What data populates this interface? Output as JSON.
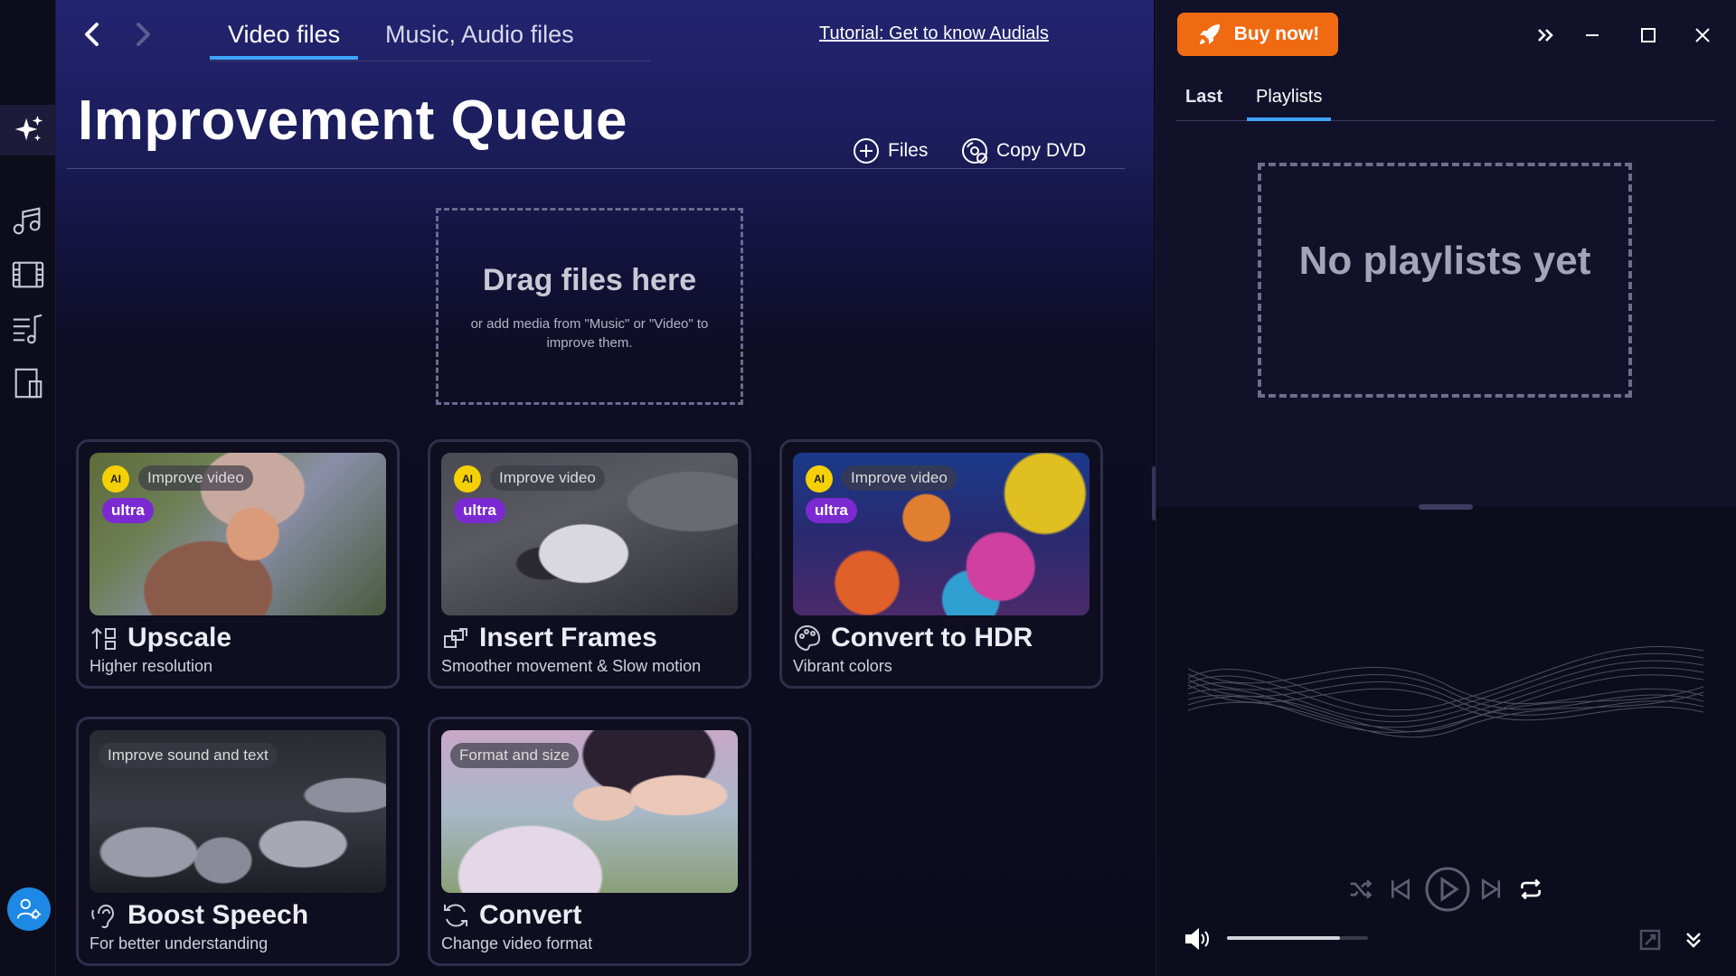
{
  "nav": {
    "tabs": [
      {
        "label": "Video files",
        "active": true
      },
      {
        "label": "Music, Audio files",
        "active": false
      }
    ],
    "tutorial_link": "Tutorial: Get to know Audials"
  },
  "page": {
    "title": "Improvement Queue",
    "actions": {
      "files": "Files",
      "copy_dvd": "Copy DVD"
    }
  },
  "dropzone": {
    "title": "Drag files here",
    "subtitle": "or add media from \"Music\" or \"Video\" to improve them."
  },
  "cards": [
    {
      "tag": "Improve video",
      "ai_badge": "AI",
      "quality": "ultra",
      "title": "Upscale",
      "subtitle": "Higher resolution",
      "icon": "upscale-icon"
    },
    {
      "tag": "Improve video",
      "ai_badge": "AI",
      "quality": "ultra",
      "title": "Insert Frames",
      "subtitle": "Smoother movement & Slow motion",
      "icon": "frames-icon"
    },
    {
      "tag": "Improve video",
      "ai_badge": "AI",
      "quality": "ultra",
      "title": "Convert to HDR",
      "subtitle": "Vibrant colors",
      "icon": "palette-icon"
    },
    {
      "tag": "Improve sound and text",
      "title": "Boost Speech",
      "subtitle": "For better understanding",
      "icon": "ear-icon"
    },
    {
      "tag": "Format and size",
      "title": "Convert",
      "subtitle": "Change video format",
      "icon": "convert-icon"
    }
  ],
  "right_panel": {
    "buy_label": "Buy now!",
    "tabs": [
      {
        "label": "Last",
        "active": false
      },
      {
        "label": "Playlists",
        "active": true
      }
    ],
    "empty_text": "No playlists yet"
  },
  "player": {
    "volume": 0.8
  },
  "colors": {
    "accent": "#3ea4ff",
    "buy": "#f06a12",
    "ai_badge": "#f5d000",
    "ultra": "#7a2ad0",
    "user": "#1e88e5"
  }
}
